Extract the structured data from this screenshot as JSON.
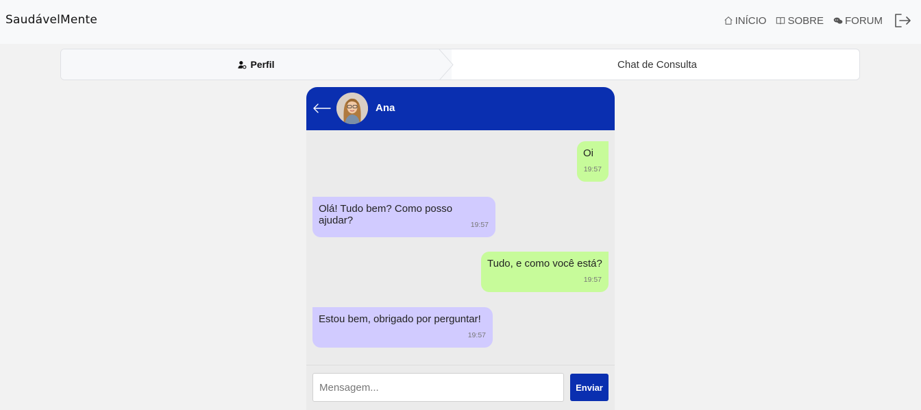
{
  "navbar": {
    "brand": "SaudávelMente",
    "links": [
      {
        "label": "INÍCIO",
        "icon": "home-icon"
      },
      {
        "label": "SOBRE",
        "icon": "book-icon"
      },
      {
        "label": "FORUM",
        "icon": "chat-bubbles-icon"
      }
    ],
    "logout_icon": "logout-icon"
  },
  "steps": {
    "profile_label": "Perfil",
    "profile_icon": "user-gear-icon",
    "chat_label": "Chat de Consulta"
  },
  "chat": {
    "contact_name": "Ana",
    "header_color": "#0a2fb0",
    "messages": [
      {
        "direction": "sent",
        "text": "Oi",
        "time": "19:57"
      },
      {
        "direction": "received",
        "text": "Olá! Tudo bem? Como posso ajudar?",
        "time": "19:57"
      },
      {
        "direction": "sent",
        "text": "Tudo, e como você está?",
        "time": "19:57"
      },
      {
        "direction": "received",
        "text": "Estou bem, obrigado por perguntar!",
        "time": "19:57"
      }
    ],
    "composer": {
      "placeholder": "Mensagem...",
      "send_label": "Enviar"
    }
  },
  "colors": {
    "sent_bubble": "#c7fb9a",
    "received_bubble": "#d1cbff",
    "accent": "#0a2fb0"
  }
}
